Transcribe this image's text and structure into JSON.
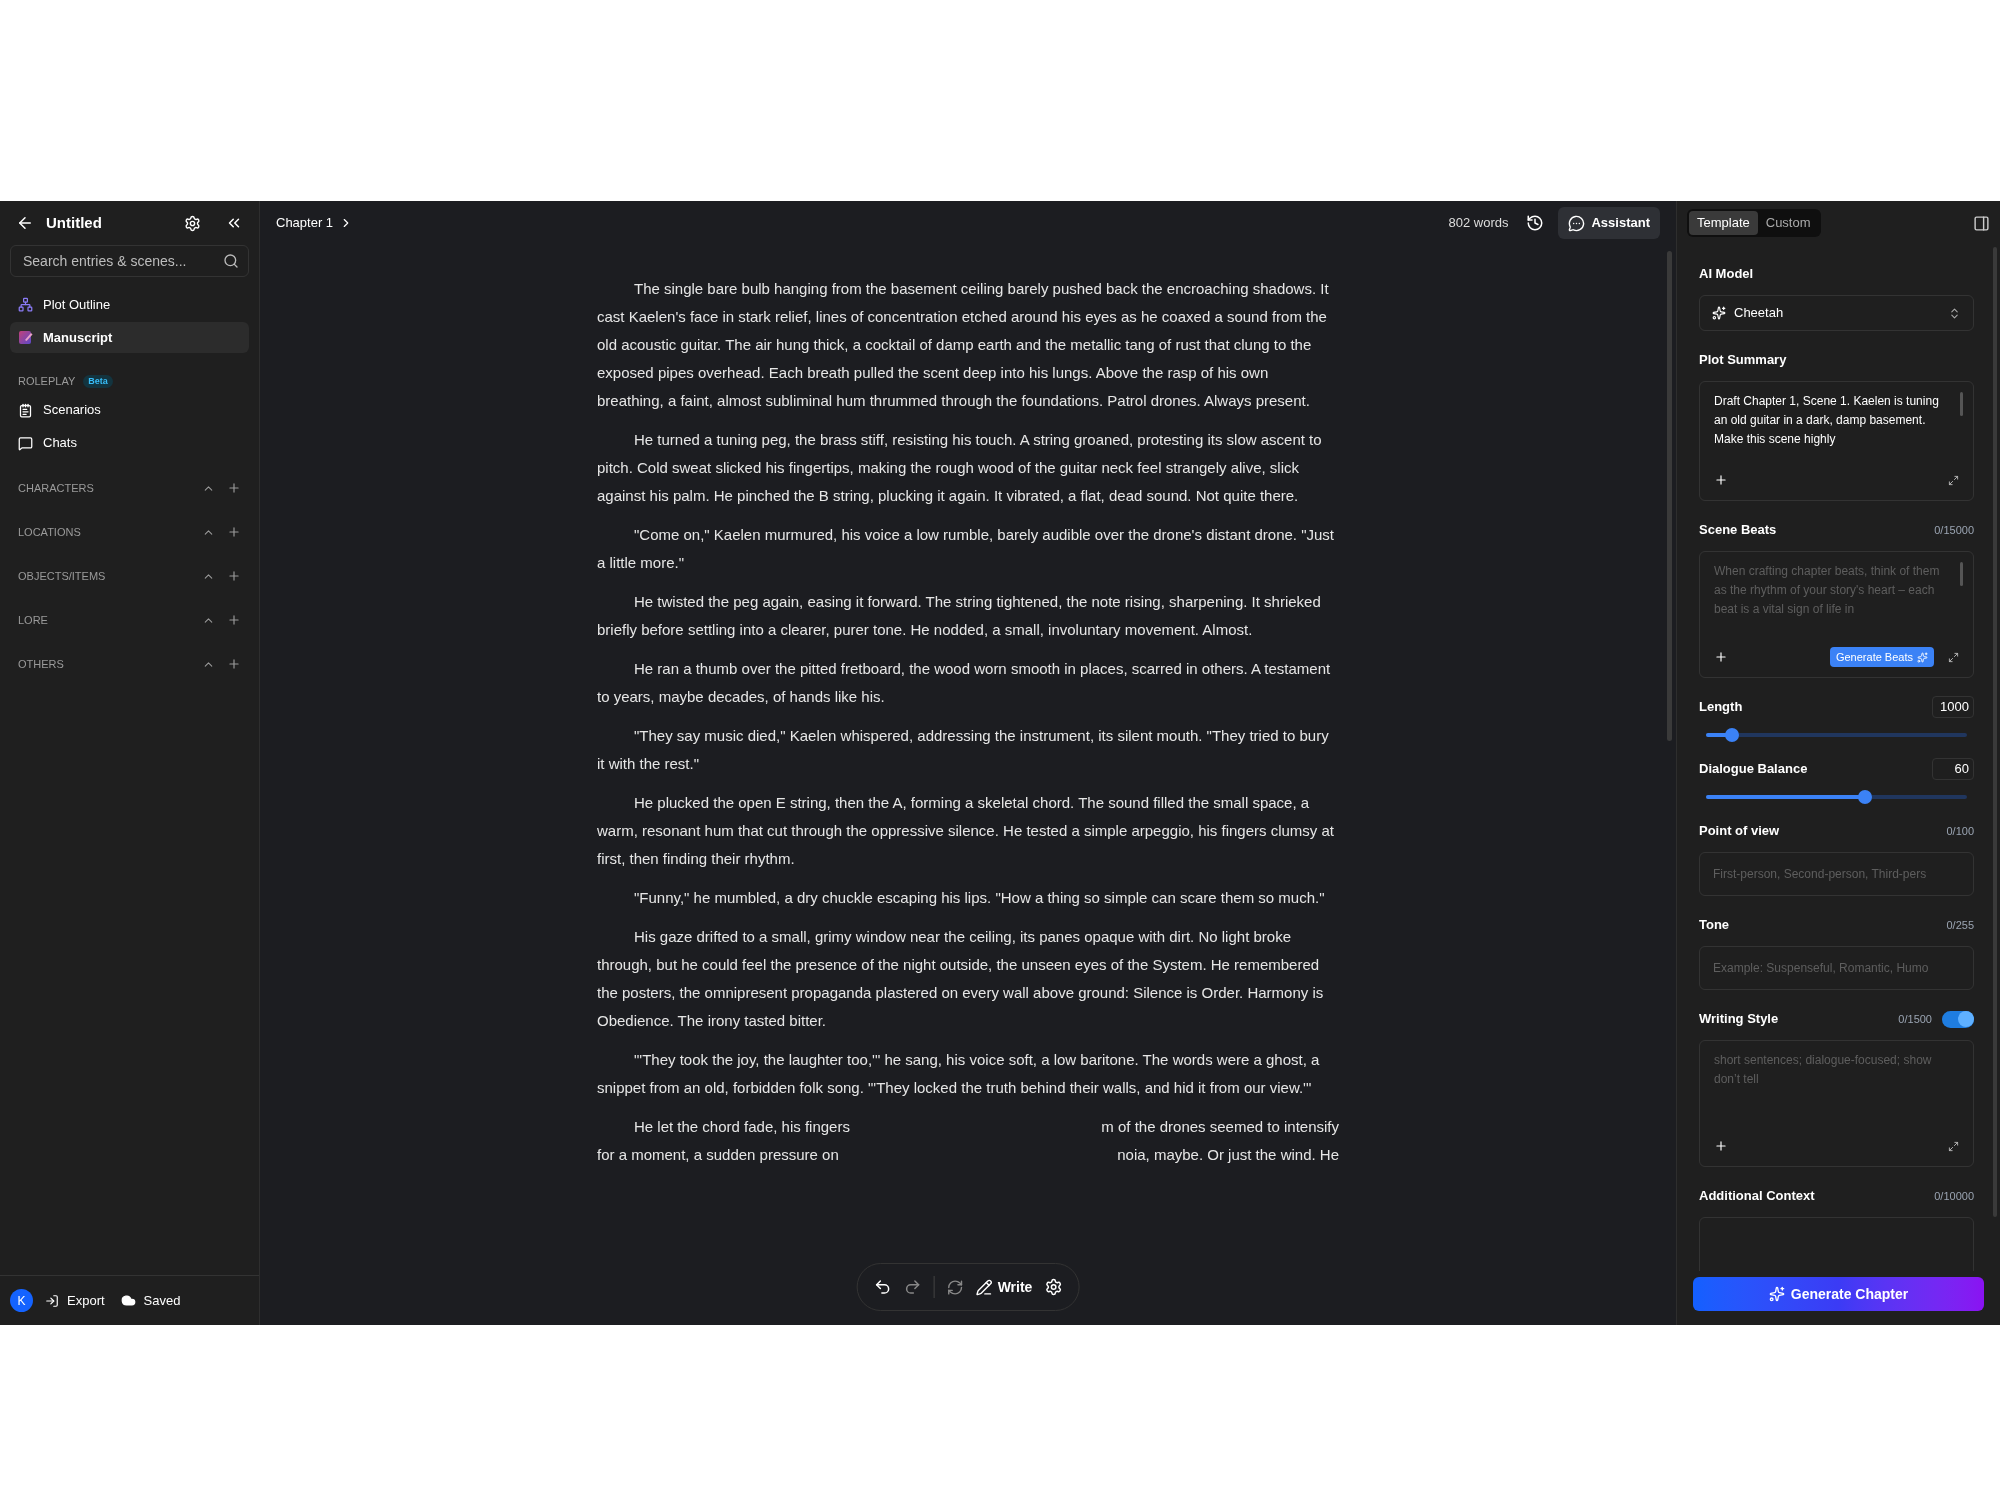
{
  "sidebar": {
    "title": "Untitled",
    "search": {
      "placeholder": "Search entries & scenes..."
    },
    "nav": [
      {
        "label": "Plot Outline",
        "kind": "outline",
        "selected": false
      },
      {
        "label": "Manuscript",
        "kind": "manuscript",
        "selected": true
      }
    ],
    "roleplay": {
      "heading": "ROLEPLAY",
      "badge": "Beta",
      "items": [
        {
          "label": "Scenarios",
          "kind": "scenarios"
        },
        {
          "label": "Chats",
          "kind": "chats"
        }
      ]
    },
    "sections": [
      {
        "label": "CHARACTERS"
      },
      {
        "label": "LOCATIONS"
      },
      {
        "label": "OBJECTS/ITEMS"
      },
      {
        "label": "LORE"
      },
      {
        "label": "OTHERS"
      }
    ],
    "footer": {
      "avatar": "K",
      "export": "Export",
      "status": "Saved"
    }
  },
  "editor": {
    "breadcrumb": "Chapter 1",
    "word_count": "802 words",
    "assistant": "Assistant",
    "paragraphs": [
      "The single bare bulb hanging from the basement ceiling barely pushed back the encroaching shadows. It cast Kaelen's face in stark relief, lines of concentration etched around his eyes as he coaxed a sound from the old acoustic guitar. The air hung thick, a cocktail of damp earth and the metallic tang of rust that clung to the exposed pipes overhead. Each breath pulled the scent deep into his lungs. Above the rasp of his own breathing, a faint, almost subliminal hum thrummed through the foundations. Patrol drones. Always present.",
      "He turned a tuning peg, the brass stiff, resisting his touch. A string groaned, protesting its slow ascent to pitch. Cold sweat slicked his fingertips, making the rough wood of the guitar neck feel strangely alive, slick against his palm. He pinched the B string, plucking it again. It vibrated, a flat, dead sound. Not quite there.",
      "\"Come on,\" Kaelen murmured, his voice a low rumble, barely audible over the drone's distant drone. \"Just a little more.\"",
      "He twisted the peg again, easing it forward. The string tightened, the note rising, sharpening. It shrieked briefly before settling into a clearer, purer tone. He nodded, a small, involuntary movement. Almost.",
      "He ran a thumb over the pitted fretboard, the wood worn smooth in places, scarred in others. A testament to years, maybe decades, of hands like his.",
      "\"They say music died,\" Kaelen whispered, addressing the instrument, its silent mouth. \"They tried to bury it with the rest.\"",
      "He plucked the open E string, then the A, forming a skeletal chord. The sound filled the small space, a warm, resonant hum that cut through the oppressive silence. He tested a simple arpeggio, his fingers clumsy at first, then finding their rhythm.",
      "\"Funny,\" he mumbled, a dry chuckle escaping his lips. \"How a thing so simple can scare them so much.\"",
      "His gaze drifted to a small, grimy window near the ceiling, its panes opaque with dirt. No light broke through, but he could feel the presence of the night outside, the unseen eyes of the System. He remembered the posters, the omnipresent propaganda plastered on every wall above ground: Silence is Order. Harmony is Obedience. The irony tasted bitter.",
      "\"'They took the joy, the laughter too,'\" he sang, his voice soft, a low baritone. The words were a ghost, a snippet from an old, forbidden folk song. \"'They locked the truth behind their walls, and hid it from our view.'\""
    ],
    "covered_paragraph": [
      {
        "left": "He let the chord fade, his fingers",
        "right": "m of the drones seemed to intensify"
      },
      {
        "left": "for a moment, a sudden pressure on",
        "right": "noia, maybe. Or just the wind. He"
      }
    ],
    "toolbar": {
      "write": "Write"
    }
  },
  "panel": {
    "tabs": [
      {
        "label": "Template",
        "selected": true
      },
      {
        "label": "Custom",
        "selected": false
      }
    ],
    "fields": [
      {
        "kind": "select",
        "label": "AI Model",
        "value": "Cheetah"
      },
      {
        "kind": "textarea",
        "label": "Plot Summary",
        "value": "Draft Chapter 1, Scene 1. Kaelen is tuning an old guitar in a dark, damp basement. Make this scene highly",
        "scrollable": true,
        "expandable": true
      },
      {
        "kind": "textarea",
        "label": "Scene Beats",
        "count": "0/15000",
        "placeholder": "When crafting chapter beats, think of them as the rhythm of your story's heart – each beat is a vital sign of life in",
        "scrollable": true,
        "expandable": true,
        "action": "Generate Beats"
      },
      {
        "kind": "slider",
        "label": "Length",
        "value": "1000",
        "level": 0.1
      },
      {
        "kind": "slider",
        "label": "Dialogue Balance",
        "value": "60",
        "level": 0.61
      },
      {
        "kind": "input",
        "label": "Point of view",
        "count": "0/100",
        "placeholder": "First-person, Second-person, Third-pers"
      },
      {
        "kind": "input",
        "label": "Tone",
        "count": "0/255",
        "placeholder": "Example: Suspenseful, Romantic, Humo"
      },
      {
        "kind": "textarea",
        "label": "Writing Style",
        "count": "0/1500",
        "toggle": {
          "on": true
        },
        "placeholder": "short sentences; dialogue-focused; show don’t tell",
        "expandable": true
      },
      {
        "kind": "textarea",
        "label": "Additional Context",
        "count": "0/10000"
      }
    ],
    "generate": "Generate Chapter"
  }
}
